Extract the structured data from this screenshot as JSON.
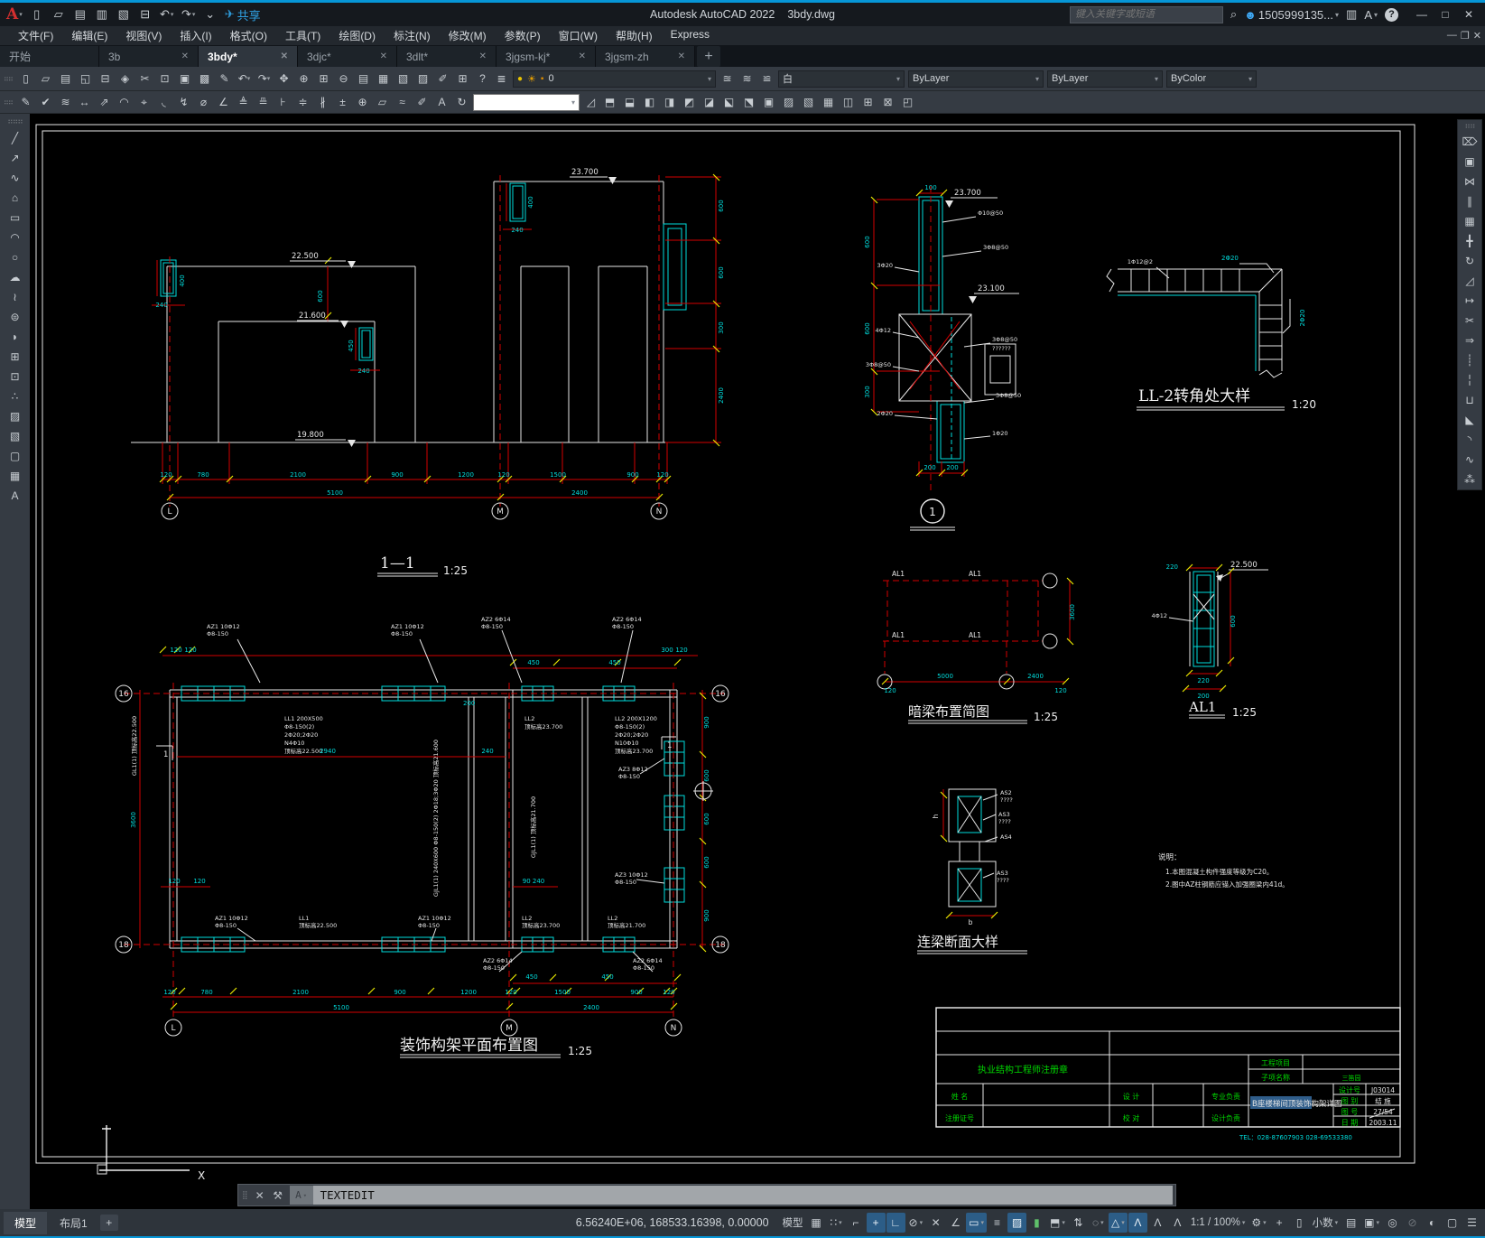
{
  "colors": {
    "accent": "#0696d7",
    "cad_red": "#d40000",
    "cad_cyan": "#00dcdc",
    "cad_green": "#00d800",
    "selection_blue": "#2f5d8a",
    "status_on": "#2c5d87"
  },
  "titlebar": {
    "app_title": "Autodesk AutoCAD 2022",
    "doc_title": "3bdy.dwg",
    "search_placeholder": "键入关键字或短语",
    "user_id": "1505999135...",
    "qat": [
      {
        "name": "app-menu-button",
        "glyph": "A",
        "cls": "logo",
        "caret": "▾"
      },
      {
        "name": "new-file-button",
        "glyph": "▯"
      },
      {
        "name": "open-file-button",
        "glyph": "▱"
      },
      {
        "name": "save-button",
        "glyph": "▤"
      },
      {
        "name": "save-as-button",
        "glyph": "▥"
      },
      {
        "name": "open-web-button",
        "glyph": "▧"
      },
      {
        "name": "plot-button",
        "glyph": "⊟"
      },
      {
        "name": "undo-button",
        "glyph": "↶",
        "caret": "▾"
      },
      {
        "name": "redo-button",
        "glyph": "↷",
        "caret": "▾"
      },
      {
        "name": "qat-customize-button",
        "glyph": "⌄"
      },
      {
        "name": "share-button",
        "glyph": "✈",
        "label": "共享",
        "cls": "share"
      }
    ]
  },
  "menubar": {
    "items": [
      {
        "name": "menu-file",
        "label": "文件(F)"
      },
      {
        "name": "menu-edit",
        "label": "编辑(E)"
      },
      {
        "name": "menu-view",
        "label": "视图(V)"
      },
      {
        "name": "menu-insert",
        "label": "插入(I)"
      },
      {
        "name": "menu-format",
        "label": "格式(O)"
      },
      {
        "name": "menu-tools",
        "label": "工具(T)"
      },
      {
        "name": "menu-draw",
        "label": "绘图(D)"
      },
      {
        "name": "menu-dimension",
        "label": "标注(N)"
      },
      {
        "name": "menu-modify",
        "label": "修改(M)"
      },
      {
        "name": "menu-parametric",
        "label": "参数(P)"
      },
      {
        "name": "menu-window",
        "label": "窗口(W)"
      },
      {
        "name": "menu-help",
        "label": "帮助(H)"
      },
      {
        "name": "menu-express",
        "label": "Express"
      }
    ]
  },
  "tabs": {
    "items": [
      {
        "name": "tab-start",
        "label": "开始"
      },
      {
        "name": "tab-3b",
        "label": "3b",
        "close": "✕"
      },
      {
        "name": "tab-3bdy",
        "label": "3bdy*",
        "close": "✕",
        "active": true
      },
      {
        "name": "tab-3djc",
        "label": "3djc*",
        "close": "✕"
      },
      {
        "name": "tab-3dlt",
        "label": "3dlt*",
        "close": "✕"
      },
      {
        "name": "tab-3jgsm-kj",
        "label": "3jgsm-kj*",
        "close": "✕"
      },
      {
        "name": "tab-3jgsm-zh",
        "label": "3jgsm-zh",
        "close": "✕"
      }
    ],
    "new_tab": "+"
  },
  "toolbar1": {
    "std": [
      {
        "name": "new-icon",
        "glyph": "▯"
      },
      {
        "name": "open-icon",
        "glyph": "▱"
      },
      {
        "name": "save-icon",
        "glyph": "▤"
      },
      {
        "name": "plot-preview-icon",
        "glyph": "◱"
      },
      {
        "name": "print-icon",
        "glyph": "⊟"
      },
      {
        "name": "publish-icon",
        "glyph": "◈"
      },
      {
        "name": "cut-icon",
        "glyph": "✂"
      },
      {
        "name": "copy-clip-icon",
        "glyph": "⊡"
      },
      {
        "name": "paste-icon",
        "glyph": "▣"
      },
      {
        "name": "paste-special-icon",
        "glyph": "▩"
      },
      {
        "name": "match-properties-icon",
        "glyph": "✎"
      },
      {
        "name": "undo-icon",
        "glyph": "↶",
        "caret": "▾"
      },
      {
        "name": "redo-icon",
        "glyph": "↷",
        "caret": "▾"
      },
      {
        "name": "pan-icon",
        "glyph": "✥"
      },
      {
        "name": "zoom-realtime-icon",
        "glyph": "⊕"
      },
      {
        "name": "zoom-window-icon",
        "glyph": "⊞"
      },
      {
        "name": "zoom-previous-icon",
        "glyph": "⊖"
      },
      {
        "name": "properties-icon",
        "glyph": "▤"
      },
      {
        "name": "designcenter-icon",
        "glyph": "▦"
      },
      {
        "name": "tool-palettes-icon",
        "glyph": "▧"
      },
      {
        "name": "sheet-set-icon",
        "glyph": "▨"
      },
      {
        "name": "markup-icon",
        "glyph": "✐"
      },
      {
        "name": "quickcalc-icon",
        "glyph": "⊞"
      },
      {
        "name": "help-icon",
        "glyph": "?"
      }
    ],
    "layer_tools_icon": "≣",
    "layer": {
      "bulb": "●",
      "sun": "☀",
      "lock": "▪",
      "current": "0"
    },
    "layer_states": [
      {
        "name": "layer-state-1-icon",
        "glyph": "≊"
      },
      {
        "name": "layer-state-2-icon",
        "glyph": "≋"
      },
      {
        "name": "layer-state-3-icon",
        "glyph": "≌"
      }
    ],
    "color_value": "白",
    "linetype_value": "ByLayer",
    "lineweight_value": "ByLayer",
    "plotstyle_value": "ByColor"
  },
  "toolbar2": {
    "left": [
      {
        "name": "mtext-edit-icon",
        "glyph": "✎"
      },
      {
        "name": "check-standards-icon",
        "glyph": "✔"
      },
      {
        "name": "layer-translator-icon",
        "glyph": "≋"
      }
    ],
    "dims": [
      {
        "name": "dim-linear-icon",
        "glyph": "↔"
      },
      {
        "name": "dim-aligned-icon",
        "glyph": "⇗"
      },
      {
        "name": "dim-arclength-icon",
        "glyph": "◠"
      },
      {
        "name": "dim-ordinate-icon",
        "glyph": "⌖"
      },
      {
        "name": "dim-radius-icon",
        "glyph": "◟"
      },
      {
        "name": "dim-jogged-icon",
        "glyph": "↯"
      },
      {
        "name": "dim-diameter-icon",
        "glyph": "⌀"
      },
      {
        "name": "dim-angular-icon",
        "glyph": "∠"
      },
      {
        "name": "quick-dim-icon",
        "glyph": "≜"
      },
      {
        "name": "dim-baseline-icon",
        "glyph": "≞"
      },
      {
        "name": "dim-continue-icon",
        "glyph": "⊦"
      },
      {
        "name": "dim-space-icon",
        "glyph": "≑"
      },
      {
        "name": "dim-break-icon",
        "glyph": "∦"
      },
      {
        "name": "tolerance-icon",
        "glyph": "±"
      },
      {
        "name": "center-mark-icon",
        "glyph": "⊕"
      },
      {
        "name": "inspection-icon",
        "glyph": "▱"
      },
      {
        "name": "jog-line-icon",
        "glyph": "≈"
      },
      {
        "name": "dim-edit-icon",
        "glyph": "✐"
      },
      {
        "name": "dim-text-edit-icon",
        "glyph": "A"
      },
      {
        "name": "dim-update-icon",
        "glyph": "↻"
      }
    ],
    "dim_style_value": "",
    "dim_style_icon": "◿",
    "solids": [
      {
        "name": "union-icon",
        "glyph": "⬒"
      },
      {
        "name": "subtract-icon",
        "glyph": "⬓"
      },
      {
        "name": "intersect-icon",
        "glyph": "◧"
      },
      {
        "name": "extrude-faces-icon",
        "glyph": "◨"
      },
      {
        "name": "move-faces-icon",
        "glyph": "◩"
      },
      {
        "name": "offset-faces-icon",
        "glyph": "◪"
      },
      {
        "name": "delete-faces-icon",
        "glyph": "⬕"
      },
      {
        "name": "rotate-faces-icon",
        "glyph": "⬔"
      },
      {
        "name": "taper-faces-icon",
        "glyph": "▣"
      },
      {
        "name": "copy-faces-icon",
        "glyph": "▨"
      },
      {
        "name": "color-faces-icon",
        "glyph": "▧"
      },
      {
        "name": "imprint-icon",
        "glyph": "▦"
      },
      {
        "name": "clean-icon",
        "glyph": "◫"
      },
      {
        "name": "separate-icon",
        "glyph": "⊞"
      },
      {
        "name": "shell-icon",
        "glyph": "⊠"
      },
      {
        "name": "check-icon",
        "glyph": "◰"
      }
    ]
  },
  "draw_toolbar": [
    {
      "name": "line-icon",
      "glyph": "╱"
    },
    {
      "name": "construction-line-icon",
      "glyph": "↗"
    },
    {
      "name": "polyline-icon",
      "glyph": "∿"
    },
    {
      "name": "polygon-icon",
      "glyph": "⌂"
    },
    {
      "name": "rectangle-icon",
      "glyph": "▭"
    },
    {
      "name": "arc-icon",
      "glyph": "◠"
    },
    {
      "name": "circle-icon",
      "glyph": "○"
    },
    {
      "name": "revcloud-icon",
      "glyph": "☁"
    },
    {
      "name": "spline-icon",
      "glyph": "≀"
    },
    {
      "name": "ellipse-icon",
      "glyph": "⊜"
    },
    {
      "name": "ellipse-arc-icon",
      "glyph": "◗"
    },
    {
      "name": "insert-block-icon",
      "glyph": "⊞"
    },
    {
      "name": "make-block-icon",
      "glyph": "⊡"
    },
    {
      "name": "point-icon",
      "glyph": "∴"
    },
    {
      "name": "hatch-icon",
      "glyph": "▨"
    },
    {
      "name": "gradient-icon",
      "glyph": "▧"
    },
    {
      "name": "region-icon",
      "glyph": "▢"
    },
    {
      "name": "table-icon",
      "glyph": "▦"
    },
    {
      "name": "mtext-icon",
      "glyph": "A"
    }
  ],
  "modify_toolbar": [
    {
      "name": "erase-icon",
      "glyph": "⌦"
    },
    {
      "name": "copy-icon",
      "glyph": "▣"
    },
    {
      "name": "mirror-icon",
      "glyph": "⋈"
    },
    {
      "name": "offset-icon",
      "glyph": "∥"
    },
    {
      "name": "array-icon",
      "glyph": "▦"
    },
    {
      "name": "move-icon",
      "glyph": "╋"
    },
    {
      "name": "rotate-icon",
      "glyph": "↻"
    },
    {
      "name": "scale-icon",
      "glyph": "◿"
    },
    {
      "name": "stretch-icon",
      "glyph": "↦"
    },
    {
      "name": "trim-icon",
      "glyph": "✂"
    },
    {
      "name": "extend-icon",
      "glyph": "⇒"
    },
    {
      "name": "break-point-icon",
      "glyph": "┊"
    },
    {
      "name": "break-icon",
      "glyph": "╎"
    },
    {
      "name": "join-icon",
      "glyph": "⊔"
    },
    {
      "name": "chamfer-icon",
      "glyph": "◣"
    },
    {
      "name": "fillet-icon",
      "glyph": "◝"
    },
    {
      "name": "blend-icon",
      "glyph": "∿"
    },
    {
      "name": "explode-icon",
      "glyph": "⁂"
    }
  ],
  "command_line": {
    "close": "✕",
    "tools": "⚒",
    "chip": "A",
    "chip_caret": "▾",
    "value": "TEXTEDIT"
  },
  "statusbar": {
    "model_tab": "模型",
    "layout_tab": "布局1",
    "new_layout": "+",
    "coordinates": "6.56240E+06, 168533.16398, 0.00000",
    "buttons": [
      {
        "name": "statusbar-model-button",
        "label": "模型"
      },
      {
        "name": "grid-icon",
        "glyph": "▦"
      },
      {
        "name": "snap-mode-icon",
        "glyph": "∷",
        "caret": "▾"
      },
      {
        "name": "dynamic-input-icon",
        "glyph": "⌐"
      },
      {
        "name": "snap-toggle-icon",
        "glyph": "+",
        "on": true
      },
      {
        "name": "ortho-mode-icon",
        "glyph": "∟",
        "on": true
      },
      {
        "name": "polar-tracking-icon",
        "glyph": "⊘",
        "caret": "▾"
      },
      {
        "name": "osnap-tracking-icon",
        "glyph": "✕"
      },
      {
        "name": "angle-override-icon",
        "glyph": "∠"
      },
      {
        "name": "isodraft-icon",
        "glyph": "▭",
        "on": true,
        "caret": "▾"
      },
      {
        "name": "lineweight-display-icon",
        "glyph": "≡"
      },
      {
        "name": "transparency-icon",
        "glyph": "▨",
        "on": true
      },
      {
        "name": "selection-cycling-icon",
        "glyph": "▮",
        "cls": "green"
      },
      {
        "name": "3d-osnap-icon",
        "glyph": "⬒",
        "caret": "▾"
      },
      {
        "name": "ucs-follow-icon",
        "glyph": "⇅"
      },
      {
        "name": "selection-filter-icon",
        "glyph": "◌",
        "caret": "▾"
      },
      {
        "name": "gizmo-icon",
        "glyph": "△",
        "on": true,
        "caret": "▾"
      },
      {
        "name": "annotation-visibility-icon",
        "glyph": "Λ",
        "on": true
      },
      {
        "name": "annotation-autoscale-icon",
        "glyph": "Λ"
      },
      {
        "name": "annotation-scale-icon",
        "glyph": "Λ"
      },
      {
        "name": "annotation-scale-value",
        "label": "1:1 / 100%",
        "caret": "▾"
      },
      {
        "name": "workspace-gear-icon",
        "glyph": "⚙",
        "caret": "▾"
      },
      {
        "name": "annotation-monitor-icon",
        "glyph": "+"
      },
      {
        "name": "units-icon",
        "glyph": "▯"
      },
      {
        "name": "units-value",
        "label": "小数",
        "caret": "▾"
      },
      {
        "name": "quick-properties-icon",
        "glyph": "▤"
      },
      {
        "name": "lock-ui-icon",
        "glyph": "▣",
        "caret": "▾"
      },
      {
        "name": "isolate-objects-icon",
        "glyph": "◎"
      },
      {
        "name": "hardware-accel-icon",
        "glyph": "⊘",
        "cls": "dim"
      },
      {
        "name": "graphics-performance-icon",
        "glyph": "◐",
        "cls": "check"
      },
      {
        "name": "clean-screen-icon",
        "glyph": "▢"
      },
      {
        "name": "customize-icon",
        "glyph": "☰"
      }
    ]
  },
  "drawing": {
    "chain": [
      "120",
      "780",
      "2100",
      "900",
      "1200",
      "120",
      "1500",
      "900",
      "120"
    ],
    "totals": [
      "5100",
      "2400"
    ],
    "grid": {
      "L": "L",
      "M": "M",
      "N": "N",
      "g16": "16",
      "g18": "18"
    },
    "elev": {
      "title": "1—1",
      "scale": "1:25",
      "lv1": "23.700",
      "lv2": "22.500",
      "lv3": "21.600",
      "lv4": "19.800",
      "d240": "240",
      "d400": "400",
      "d450": "450",
      "d600": "600",
      "rv": [
        "600",
        "600",
        "300",
        "2400"
      ]
    },
    "plan": {
      "title": "装饰构架平面布置图",
      "scale": "1:25",
      "az1": "AZ1 10Φ12",
      "az2": "AZ2 6Φ14",
      "az3a": "AZ3 8Φ12",
      "az3b": "AZ3 10Φ12",
      "st": "Φ8-150",
      "ll1": [
        "LL1 200X500",
        "Φ8-150(2)",
        "2Φ20;2Φ20",
        "N4Φ10",
        "顶标高22.500"
      ],
      "ll2": [
        "LL2 200X1200",
        "Φ8-150(2)",
        "2Φ20;2Φ20",
        "N10Φ10",
        "顶标高23.700"
      ],
      "ll2s": "LL2",
      "ll2sv": "顶标高23.700",
      "ll1s": "LL1",
      "ll1sv": "顶标高22.500",
      "ll2s2": "LL2",
      "ll2s2v": "顶标高21.700",
      "gl1": "GL1(1) 顶标高22.500",
      "gjl1": "GJL1(1) 240X600 Φ8-150(2) 2Φ18;3Φ20 顶标高21.600",
      "gjl2": "GJL1(1) 顶标高21.700",
      "d2940": "2940",
      "d240": "240",
      "d450": "450",
      "d120": "120",
      "d200": "200",
      "d90240": "90 240",
      "d300": "300",
      "d3600": "3600",
      "rv": [
        "900",
        "600",
        "600",
        "600",
        "900"
      ],
      "sec": "1"
    },
    "det1": {
      "num": "1",
      "lv1": "23.700",
      "lv2": "23.100",
      "d100": "100",
      "d600": "600",
      "d300": "300",
      "d200": "200",
      "left": [
        "3Φ20",
        "4Φ12",
        "3Φ8@50",
        "2Φ20"
      ],
      "right": [
        "Φ10@50",
        "3Φ8@50",
        "3Φ8@50",
        "??????",
        "3Φ8@50",
        "1Φ20"
      ]
    },
    "ll2c": {
      "title": "LL-2转角处大样",
      "scale": "1:20",
      "b1": "2Φ20",
      "b2": "2Φ20",
      "b3": "1Φ12@2"
    },
    "anl": {
      "title": "暗梁布置简图",
      "scale": "1:25",
      "al1": "AL1",
      "d5000": "5000",
      "d2400": "2400",
      "d120": "120",
      "d3600": "3600"
    },
    "al1d": {
      "title": "AL1",
      "scale": "1:25",
      "lv": "22.500",
      "d220": "220",
      "d200": "200",
      "d600": "600",
      "bars": "4Φ12"
    },
    "lb": {
      "title": "连梁断面大样",
      "as2": "AS2",
      "as3": "AS3",
      "as4": "AS4",
      "q": "????",
      "b": "b",
      "h": "h"
    },
    "notes": {
      "head": "说明：",
      "n1": "1.本图混凝土构件强度等级为C20。",
      "n2": "2.图中AZ柱钢筋应锚入加强圈梁内41d。"
    },
    "tb": {
      "stamp": "执业结构工程师注册章",
      "name": "姓  名",
      "cert": "注册证号",
      "design": "设  计",
      "check": "校  对",
      "major": "专业负责",
      "dlead": "设计负责",
      "proj": "工程项目",
      "sub": "子项名称",
      "subv": "三笛园",
      "dno_l": "设计号",
      "dno_v": "J03014",
      "dtype_l": "图 别",
      "dtype_v": "结 施",
      "dnum_l": "图 号",
      "dnum_v": "27/54",
      "date_l": "日 期",
      "date_v": "2003.11",
      "title": "B座楼梯间顶装饰构架详图",
      "tel": "TEL：028-87607903  028-69533380"
    },
    "ucs": {
      "x": "X"
    }
  }
}
